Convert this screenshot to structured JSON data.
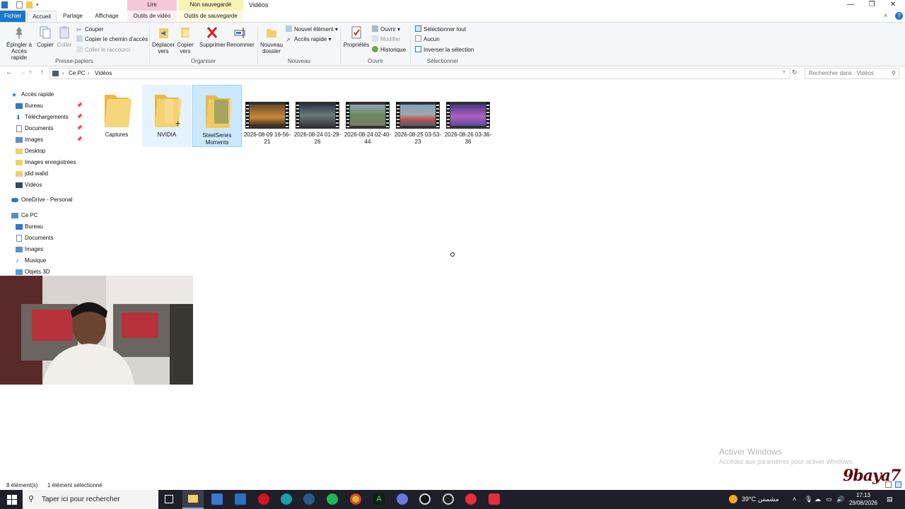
{
  "titlebar": {
    "title": "Vidéos",
    "ctx_play": "Lire",
    "ctx_unsaved": "Non sauvegardé"
  },
  "tabs": {
    "file": "Fichier",
    "home": "Accueil",
    "share": "Partage",
    "view": "Affichage",
    "video_tools": "Outils de vidéo",
    "backup_tools": "Outils de sauvegarde"
  },
  "ribbon": {
    "pin": "Épingler à Accès rapide",
    "copy": "Copier",
    "paste": "Coller",
    "cut": "Couper",
    "copy_path": "Copier le chemin d'accès",
    "paste_shortcut": "Coller le raccourci",
    "clipboard_group": "Presse-papiers",
    "move_to": "Déplacer vers",
    "copy_to": "Copier vers",
    "delete": "Supprimer",
    "rename": "Renommer",
    "organize_group": "Organiser",
    "new_folder": "Nouveau dossier",
    "new_item": "Nouvel élément",
    "easy_access": "Accès rapide",
    "new_group": "Nouveau",
    "properties": "Propriétés",
    "open": "Ouvrir",
    "edit": "Modifier",
    "history": "Historique",
    "open_group": "Ouvrir",
    "select_all": "Sélectionner tout",
    "select_none": "Aucun",
    "invert_selection": "Inverser la sélection",
    "select_group": "Sélectionner"
  },
  "address": {
    "crumb_pc": "Ce PC",
    "crumb_videos": "Vidéos",
    "search_placeholder": "Rechercher dans : Vidéos"
  },
  "nav": {
    "quick_access": "Accès rapide",
    "qa_items": [
      "Bureau",
      "Téléchargements",
      "Documents",
      "Images",
      "Desktop",
      "Images enregistrées",
      "jdid walid",
      "Vidéos"
    ],
    "onedrive": "OneDrive - Personal",
    "this_pc": "Ce PC",
    "pc_items": [
      "Bureau",
      "Documents",
      "Images",
      "Musique",
      "Objets 3D"
    ]
  },
  "items": [
    {
      "name": "Captures",
      "type": "folder"
    },
    {
      "name": "NVIDIA",
      "type": "folder"
    },
    {
      "name": "SteelSeries Moments",
      "type": "folder"
    },
    {
      "name": "2026-08-09 16-56-21",
      "type": "video"
    },
    {
      "name": "2026-08-24 01-29-26",
      "type": "video"
    },
    {
      "name": "2026-08-24 02-40-44",
      "type": "video"
    },
    {
      "name": "2026-08-25 03-53-23",
      "type": "video"
    },
    {
      "name": "2026-08-26 03-36-36",
      "type": "video"
    }
  ],
  "status": {
    "count": "8 élément(s)",
    "selected": "1 élément sélectionné"
  },
  "watermark": {
    "line1": "Activer Windows",
    "line2": "Accédez aux paramètres pour activer Windows."
  },
  "overlay_logo": "9baya7",
  "taskbar": {
    "search_placeholder": "Taper ici pour rechercher",
    "weather_temp": "39°C",
    "weather_text": "مشمس",
    "time": "17:13",
    "date": "29/08/2026"
  }
}
